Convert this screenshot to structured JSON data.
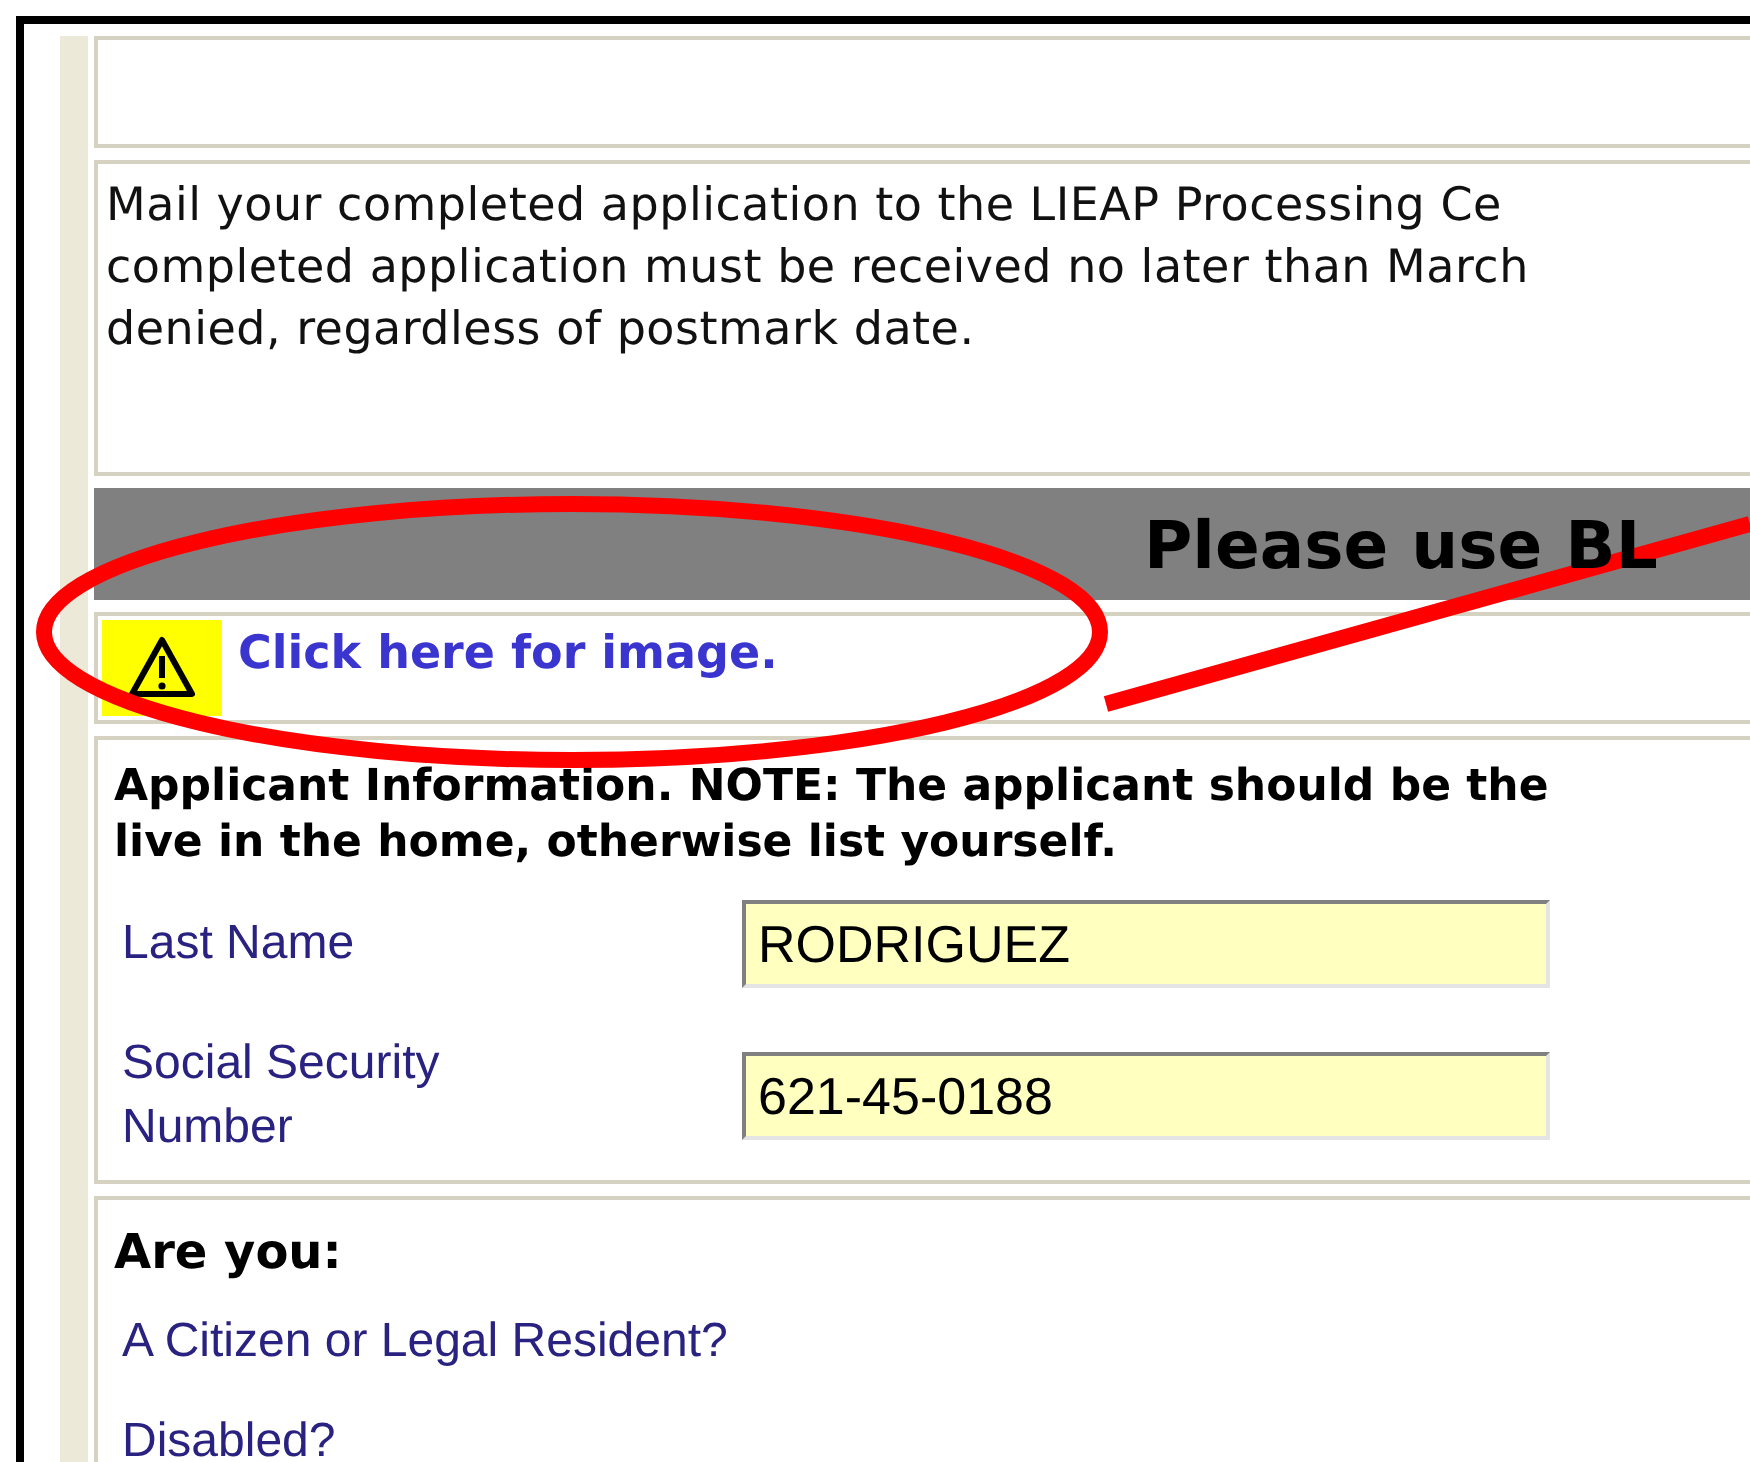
{
  "notice": {
    "lines": [
      "Mail your completed application to the LIEAP Processing Ce",
      "completed application must be received no later than March",
      "denied, regardless of postmark date."
    ]
  },
  "banner": {
    "title": "Please use BL"
  },
  "image_link": {
    "label": "Click here for image."
  },
  "applicant": {
    "heading": [
      "Applicant Information. NOTE: The applicant should be the",
      "live in the home, otherwise list yourself."
    ],
    "fields": [
      {
        "label": "Last Name",
        "value": "RODRIGUEZ"
      },
      {
        "label": "Social Security Number",
        "value": "621-45-0188"
      }
    ]
  },
  "questions": {
    "heading": "Are you:",
    "items": [
      "A Citizen or Legal Resident?",
      "Disabled?"
    ]
  }
}
